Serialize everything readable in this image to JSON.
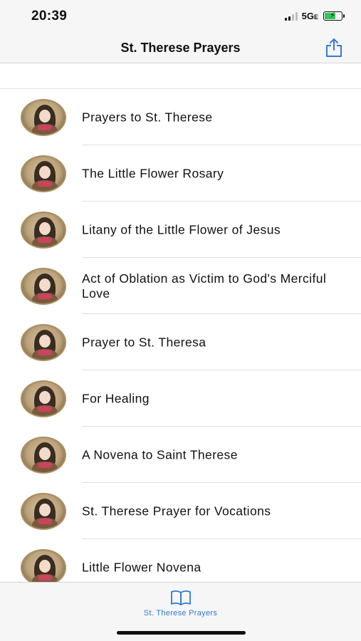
{
  "status_bar": {
    "time": "20:39",
    "network": "5G",
    "network_suffix": "E"
  },
  "nav": {
    "title": "St. Therese Prayers",
    "share_icon": "share-icon"
  },
  "prayers": [
    {
      "title": "Prayers to St. Therese"
    },
    {
      "title": "The Little Flower Rosary"
    },
    {
      "title": "Litany of the Little Flower of Jesus"
    },
    {
      "title": "Act of Oblation as Victim to God's Merciful Love"
    },
    {
      "title": "Prayer to St. Theresa"
    },
    {
      "title": "For Healing"
    },
    {
      "title": "A Novena to Saint Therese"
    },
    {
      "title": "St. Therese Prayer for Vocations"
    },
    {
      "title": "Little Flower Novena"
    }
  ],
  "tab_bar": {
    "label": "St. Therese Prayers",
    "icon": "book-icon"
  },
  "colors": {
    "accent": "#2f7bd6",
    "battery": "#35c759",
    "bar_background": "#f6f6f6"
  }
}
